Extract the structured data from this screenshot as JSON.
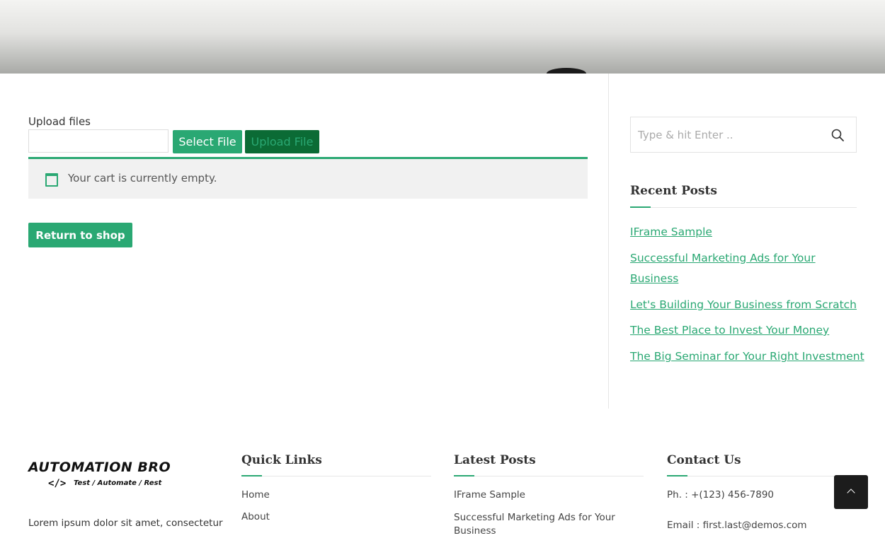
{
  "upload": {
    "label": "Upload files",
    "select_button": "Select File",
    "upload_button": "Upload File"
  },
  "cart": {
    "empty_message": "Your cart is currently empty.",
    "return_button": "Return to shop"
  },
  "sidebar": {
    "search_placeholder": "Type & hit Enter ..",
    "recent_posts_title": "Recent Posts",
    "recent_posts": [
      "IFrame Sample",
      "Successful Marketing Ads for Your Business",
      "Let's Building Your Business from Scratch",
      "The Best Place to Invest Your Money",
      "The Big Seminar for Your Right Investment"
    ]
  },
  "footer": {
    "logo_text": "AUTOMATION BRO",
    "logo_code": "</>",
    "logo_tagline": "Test / Automate / Rest",
    "about_text": "Lorem ipsum dolor sit amet, consectetur",
    "quick_links_title": "Quick Links",
    "quick_links": [
      "Home",
      "About"
    ],
    "latest_posts_title": "Latest Posts",
    "latest_posts": [
      "IFrame Sample",
      "Successful Marketing Ads for Your Business"
    ],
    "contact_title": "Contact Us",
    "phone": "Ph. : +(123) 456-7890",
    "email": "Email : first.last@demos.com"
  },
  "colors": {
    "accent": "#2aa873",
    "dark_button": "#0b6b35",
    "to_top": "#1c1c1c"
  }
}
